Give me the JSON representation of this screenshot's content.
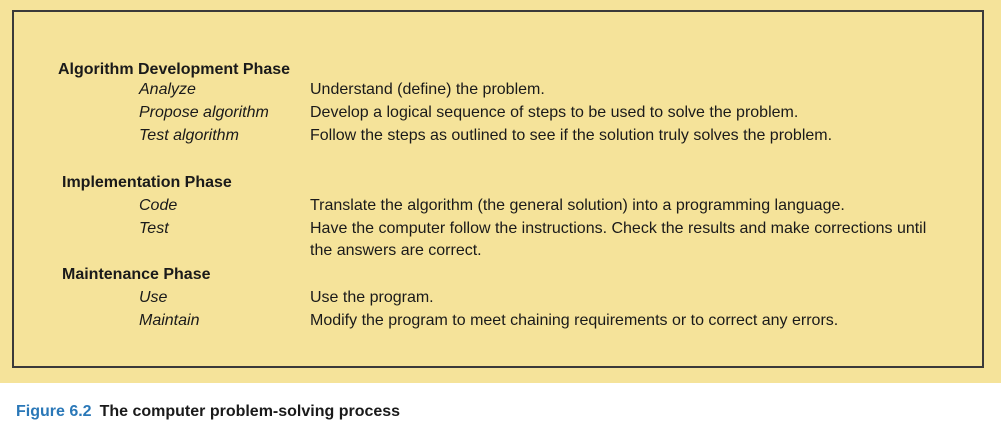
{
  "phases": [
    {
      "heading": "Algorithm Development Phase",
      "steps": [
        {
          "name": "Analyze",
          "description": "Understand (define) the problem."
        },
        {
          "name": "Propose algorithm",
          "description": "Develop a logical sequence of steps to be used to solve the problem."
        },
        {
          "name": "Test algorithm",
          "description": "Follow the steps as outlined to see if the solution truly solves the problem."
        }
      ]
    },
    {
      "heading": "Implementation Phase",
      "steps": [
        {
          "name": "Code",
          "description": "Translate the algorithm (the general solution) into a programming language."
        },
        {
          "name": "Test",
          "description": "Have the computer follow the instructions.  Check the results and make corrections until the answers are correct."
        }
      ]
    },
    {
      "heading": "Maintenance Phase",
      "steps": [
        {
          "name": "Use",
          "description": "Use the program."
        },
        {
          "name": "Maintain",
          "description": "Modify the program to meet chaining requirements or to correct any errors."
        }
      ]
    }
  ],
  "caption": {
    "number": "Figure 6.2",
    "title": "The computer problem-solving process"
  },
  "colors": {
    "box_background": "#f5e39a",
    "frame_border": "#3a3a3a",
    "caption_accent": "#2a78b8"
  }
}
